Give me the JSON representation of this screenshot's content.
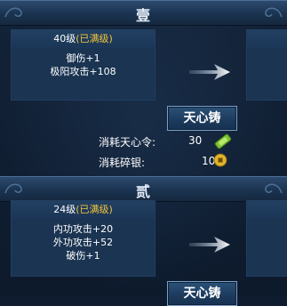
{
  "sections": [
    {
      "title": "壹",
      "level": "40级",
      "level_status": "(已满级)",
      "stats": [
        "御伤+1",
        "极阳攻击+108"
      ],
      "button_label": "天心铸",
      "costs": [
        {
          "label": "消耗天心令:",
          "value": "30"
        },
        {
          "label": "消耗碎银:",
          "value": "10"
        }
      ]
    },
    {
      "title": "贰",
      "level": "24级",
      "level_status": "(已满级)",
      "stats": [
        "内功攻击+20",
        "外功攻击+52",
        "破伤+1"
      ],
      "button_label": "天心铸"
    }
  ],
  "colors": {
    "max_level": "#f2c33a",
    "background": "#0f1c30",
    "panel": "#1a3452"
  },
  "icons": [
    "arrow-right-icon",
    "tianxin-token-icon",
    "silver-coin-icon",
    "scroll-ornament-icon"
  ]
}
